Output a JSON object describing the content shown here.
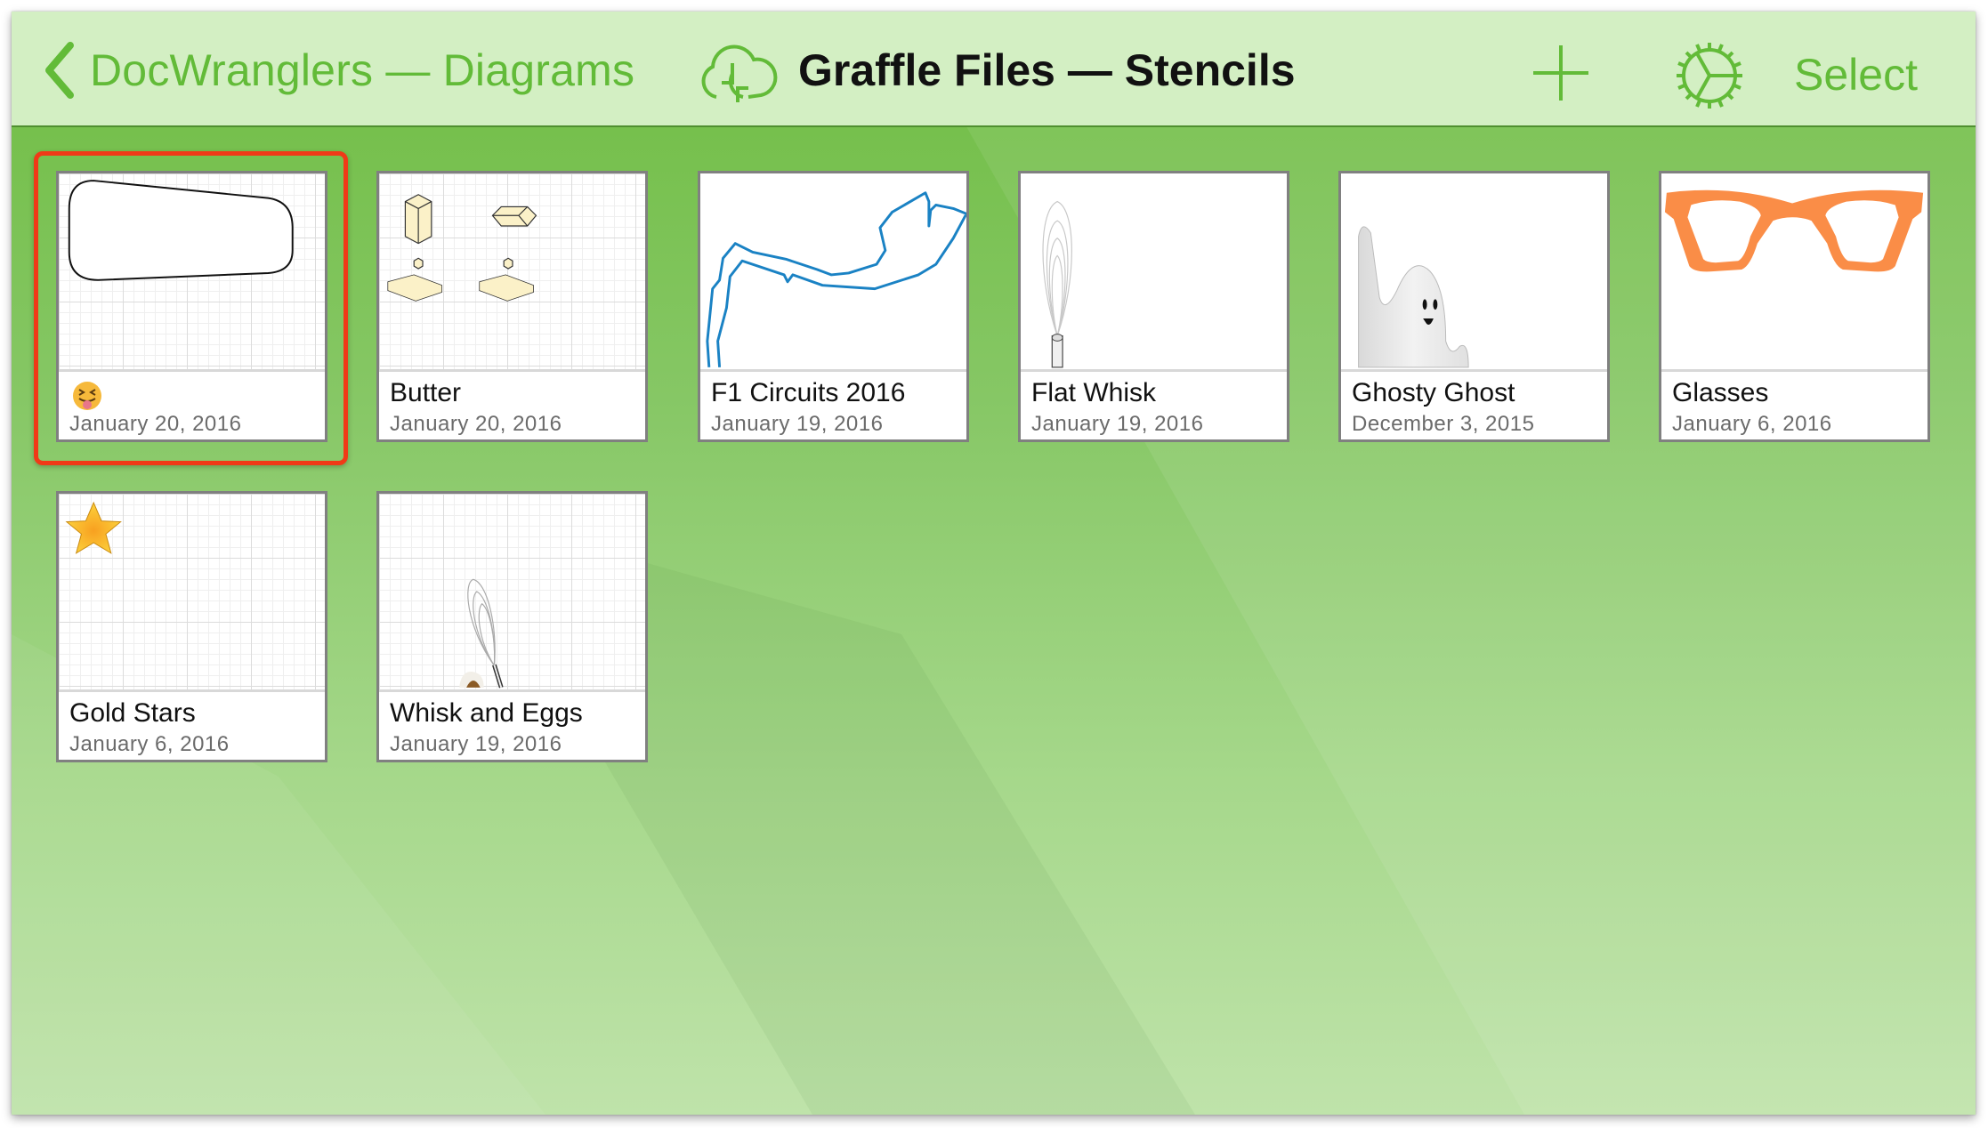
{
  "navbar": {
    "back_label": "DocWranglers — Diagrams",
    "back_icon": "chevron-left-icon",
    "sync_icon": "cloud-sync-icon",
    "title": "Graffle Files — Stencils",
    "add_icon": "plus-icon",
    "settings_icon": "gear-icon",
    "select_label": "Select"
  },
  "colors": {
    "accent": "#62bb38",
    "navbar_bg": "#d3efc3",
    "selection": "#f03a17"
  },
  "documents": [
    {
      "title": "",
      "title_emoji": "face-with-tongue-and-closed-eyes",
      "date": "January 20, 2016",
      "thumbnail": "rounded-trapezoid-shape",
      "selected": true
    },
    {
      "title": "Butter",
      "date": "January 20, 2016",
      "thumbnail": "isometric-butter-blocks"
    },
    {
      "title": "F1 Circuits 2016",
      "date": "January 19, 2016",
      "thumbnail": "race-circuit-outline"
    },
    {
      "title": "Flat Whisk",
      "date": "January 19, 2016",
      "thumbnail": "flat-whisk"
    },
    {
      "title": "Ghosty Ghost",
      "date": "December 3, 2015",
      "thumbnail": "ghost"
    },
    {
      "title": "Glasses",
      "date": "January 6, 2016",
      "thumbnail": "orange-glasses"
    },
    {
      "title": "Gold Stars",
      "date": "January 6, 2016",
      "thumbnail": "gold-star"
    },
    {
      "title": "Whisk and Eggs",
      "date": "January 19, 2016",
      "thumbnail": "whisk-and-eggs"
    }
  ]
}
